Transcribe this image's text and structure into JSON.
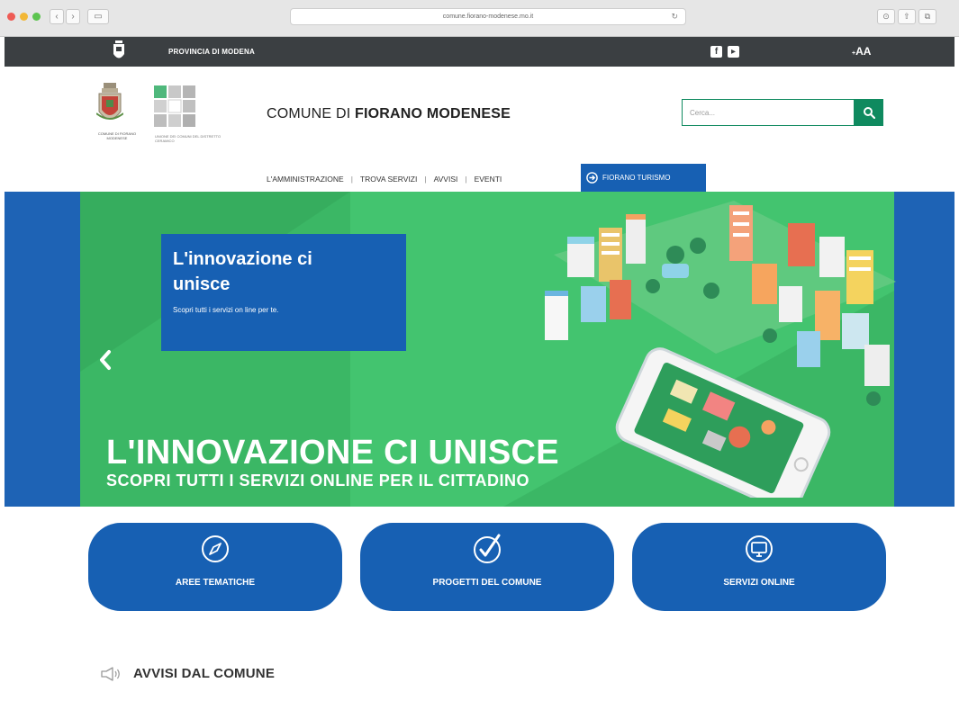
{
  "browser": {
    "url": "comune.fiorano-modenese.mo.it"
  },
  "top_bar": {
    "province": "PROVINCIA DI MODENA",
    "font_size": "AA"
  },
  "header": {
    "title_light": "COMUNE DI ",
    "title_bold": "FIORANO MODENESE",
    "crest_caption": "COMUNE DI FIORANO MODENESE",
    "union_caption": "UNIONE DEI COMUNI DEL DISTRETTO CERAMICO",
    "search_placeholder": "Cerca..."
  },
  "nav": {
    "items": [
      "L'AMMINISTRAZIONE",
      "TROVA SERVIZI",
      "AVVISI",
      "EVENTI"
    ],
    "separator": "|",
    "highlight": "FIORANO TURISMO"
  },
  "hero": {
    "card_title": "L'innovazione ci unisce",
    "card_text": "Scopri tutti i servizi on line per te.",
    "headline": "L'INNOVAZIONE CI UNISCE",
    "subheadline": "SCOPRI TUTTI I SERVIZI ONLINE PER IL CITTADINO"
  },
  "quick_links": [
    {
      "label": "AREE TEMATICHE",
      "icon": "compass-icon"
    },
    {
      "label": "PROGETTI DEL COMUNE",
      "icon": "checkmark-icon"
    },
    {
      "label": "SERVIZI ONLINE",
      "icon": "monitor-icon"
    }
  ],
  "notices": {
    "title": "AVVISI DAL COMUNE",
    "icon": "megaphone-icon"
  },
  "colors": {
    "green": "#0f8a5f",
    "blue": "#1760b3",
    "dark_bar": "#3b3f42",
    "hero_green": "#3bb765"
  }
}
